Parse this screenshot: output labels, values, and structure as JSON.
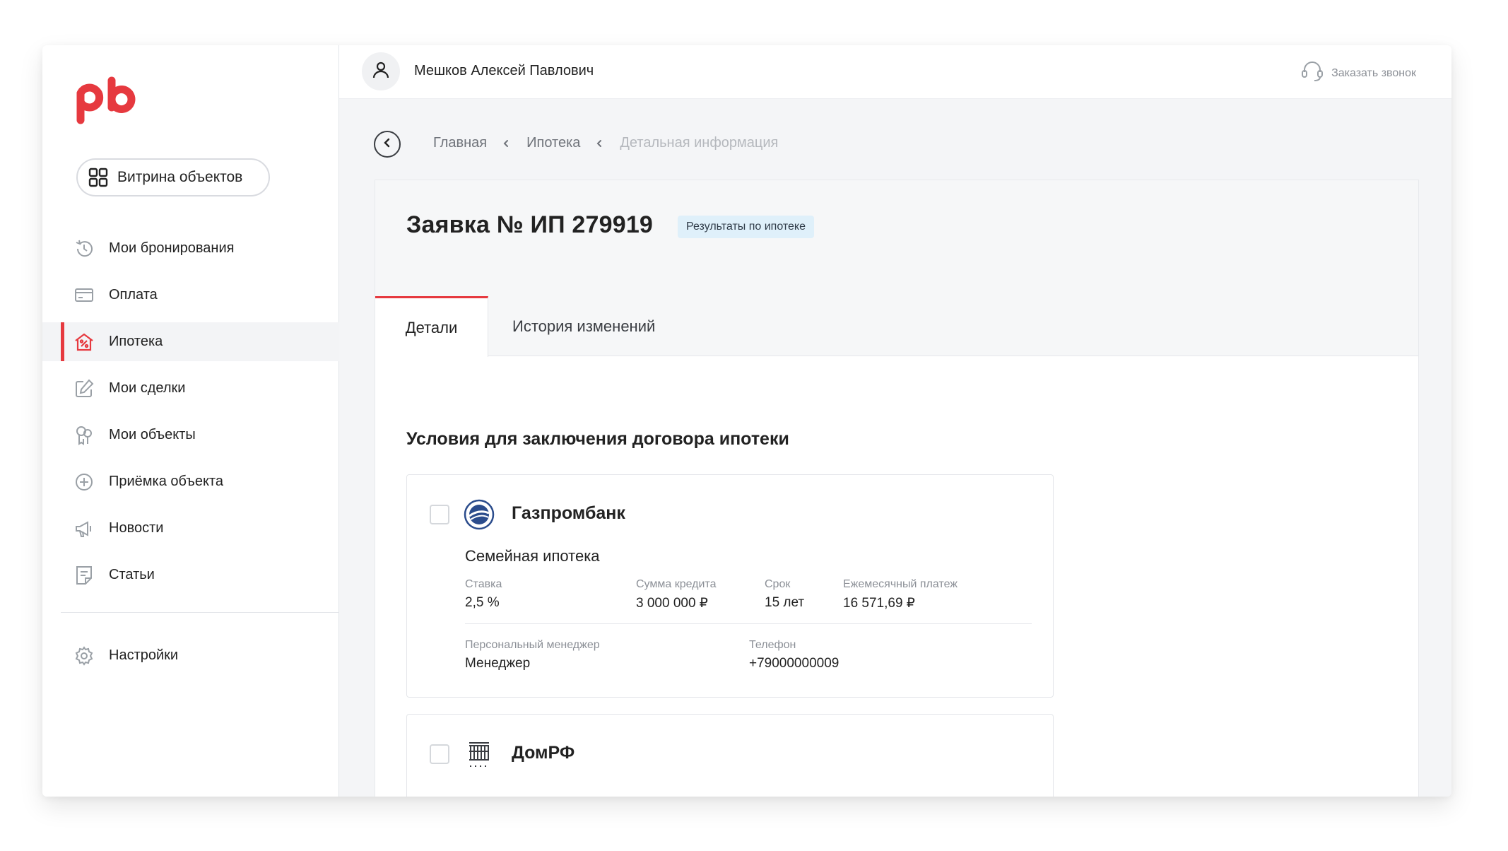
{
  "brand": {
    "accent": "#e6393f",
    "logo_text": "pb"
  },
  "sidebar": {
    "catalog_button": "Витрина объектов",
    "items": [
      {
        "label": "Мои бронирования",
        "icon": "history-icon"
      },
      {
        "label": "Оплата",
        "icon": "card-icon"
      },
      {
        "label": "Ипотека",
        "icon": "house-percent-icon",
        "active": true
      },
      {
        "label": "Мои сделки",
        "icon": "edit-icon"
      },
      {
        "label": "Мои объекты",
        "icon": "keys-icon"
      },
      {
        "label": "Приёмка объекта",
        "icon": "plus-circle-icon"
      },
      {
        "label": "Новости",
        "icon": "megaphone-icon"
      },
      {
        "label": "Статьи",
        "icon": "article-icon"
      }
    ],
    "settings": "Настройки"
  },
  "header": {
    "user_name": "Мешков Алексей Павлович",
    "callback": "Заказать звонок"
  },
  "breadcrumb": [
    "Главная",
    "Ипотека",
    "Детальная информация"
  ],
  "request": {
    "title": "Заявка № ИП 279919",
    "status": "Результаты по ипотеке",
    "tabs": [
      "Детали",
      "История изменений"
    ]
  },
  "conditions": {
    "title": "Условия для заключения договора ипотеки",
    "banks": [
      {
        "name": "Газпромбанк",
        "program": "Семейная ипотека",
        "rate_label": "Ставка",
        "rate": "2,5 %",
        "amount_label": "Сумма кредита",
        "amount": "3 000 000 ₽",
        "term_label": "Срок",
        "term": "15 лет",
        "payment_label": "Ежемесячный платеж",
        "payment": "16 571,69 ₽",
        "manager_label": "Персональный менеджер",
        "manager": "Менеджер",
        "phone_label": "Телефон",
        "phone": "+79000000009"
      },
      {
        "name": "ДомРФ"
      }
    ]
  }
}
